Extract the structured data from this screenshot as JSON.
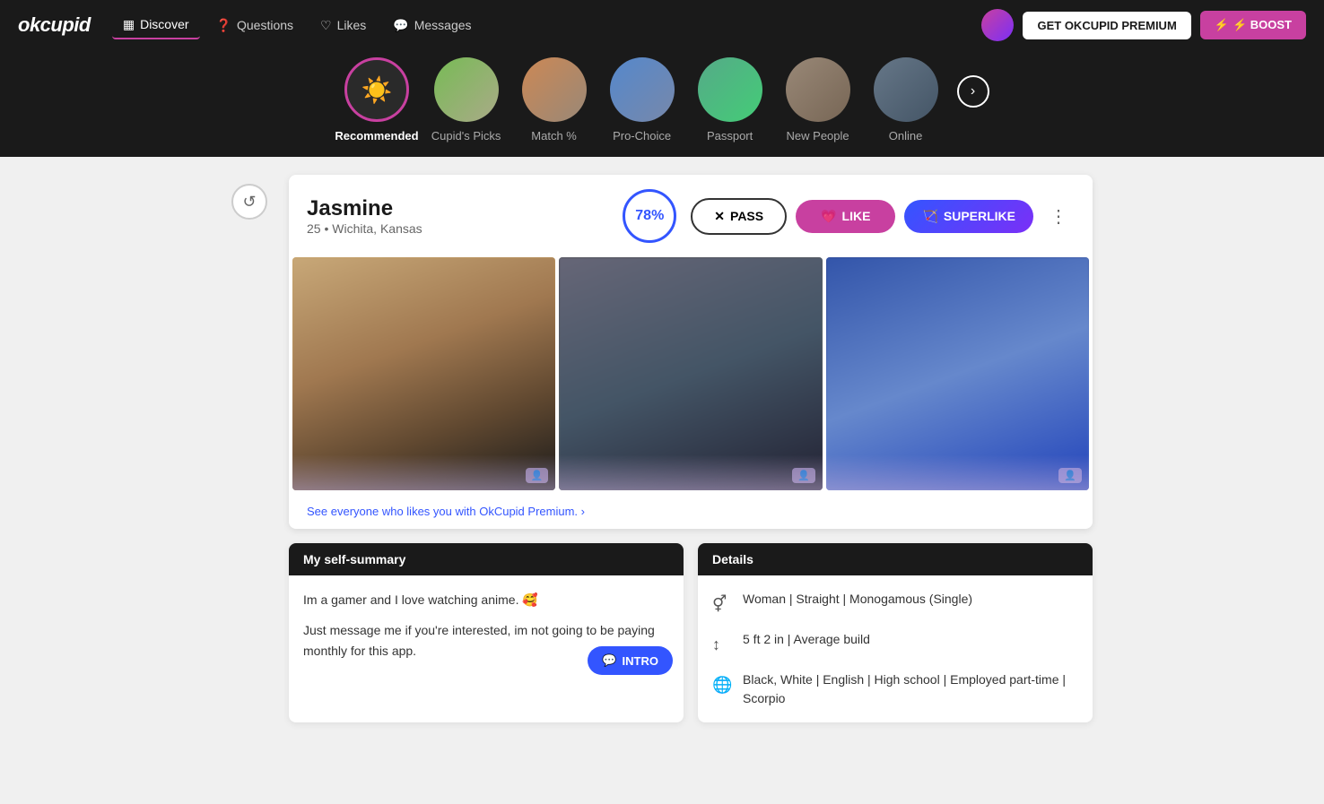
{
  "logo": "okcupid",
  "nav": {
    "items": [
      {
        "id": "discover",
        "label": "Discover",
        "active": true,
        "icon": "⊞"
      },
      {
        "id": "questions",
        "label": "Questions",
        "active": false,
        "icon": "?"
      },
      {
        "id": "likes",
        "label": "Likes",
        "active": false,
        "icon": "♡"
      },
      {
        "id": "messages",
        "label": "Messages",
        "active": false,
        "icon": "☐"
      }
    ],
    "premium_btn": "GET OKCUPID PREMIUM",
    "boost_btn": "⚡ BOOST"
  },
  "categories": [
    {
      "id": "recommended",
      "label": "Recommended",
      "active": true
    },
    {
      "id": "cupids-picks",
      "label": "Cupid's Picks",
      "active": false
    },
    {
      "id": "match",
      "label": "Match %",
      "active": false
    },
    {
      "id": "pro-choice",
      "label": "Pro-Choice",
      "active": false
    },
    {
      "id": "passport",
      "label": "Passport",
      "active": false
    },
    {
      "id": "new-people",
      "label": "New People",
      "active": false
    },
    {
      "id": "online",
      "label": "Online",
      "active": false
    }
  ],
  "profile": {
    "name": "Jasmine",
    "age": "25",
    "location": "Wichita, Kansas",
    "match_percent": "78%",
    "pass_label": "PASS",
    "like_label": "LIKE",
    "superlike_label": "SUPERLIKE",
    "premium_prompt": "See everyone who likes you with OkCupid Premium. ›",
    "self_summary_header": "My self-summary",
    "self_summary_line1": "Im a gamer and I love watching anime. 🥰",
    "self_summary_line2": "Just message me if you're interested, im not going to be paying monthly for this app.",
    "intro_label": "INTRO",
    "details_header": "Details",
    "details": [
      {
        "icon": "person",
        "text": "Woman | Straight | Monogamous (Single)"
      },
      {
        "icon": "height",
        "text": "5 ft 2 in | Average build"
      },
      {
        "icon": "globe",
        "text": "Black, White | English | High school | Employed part-time | Scorpio"
      }
    ]
  }
}
